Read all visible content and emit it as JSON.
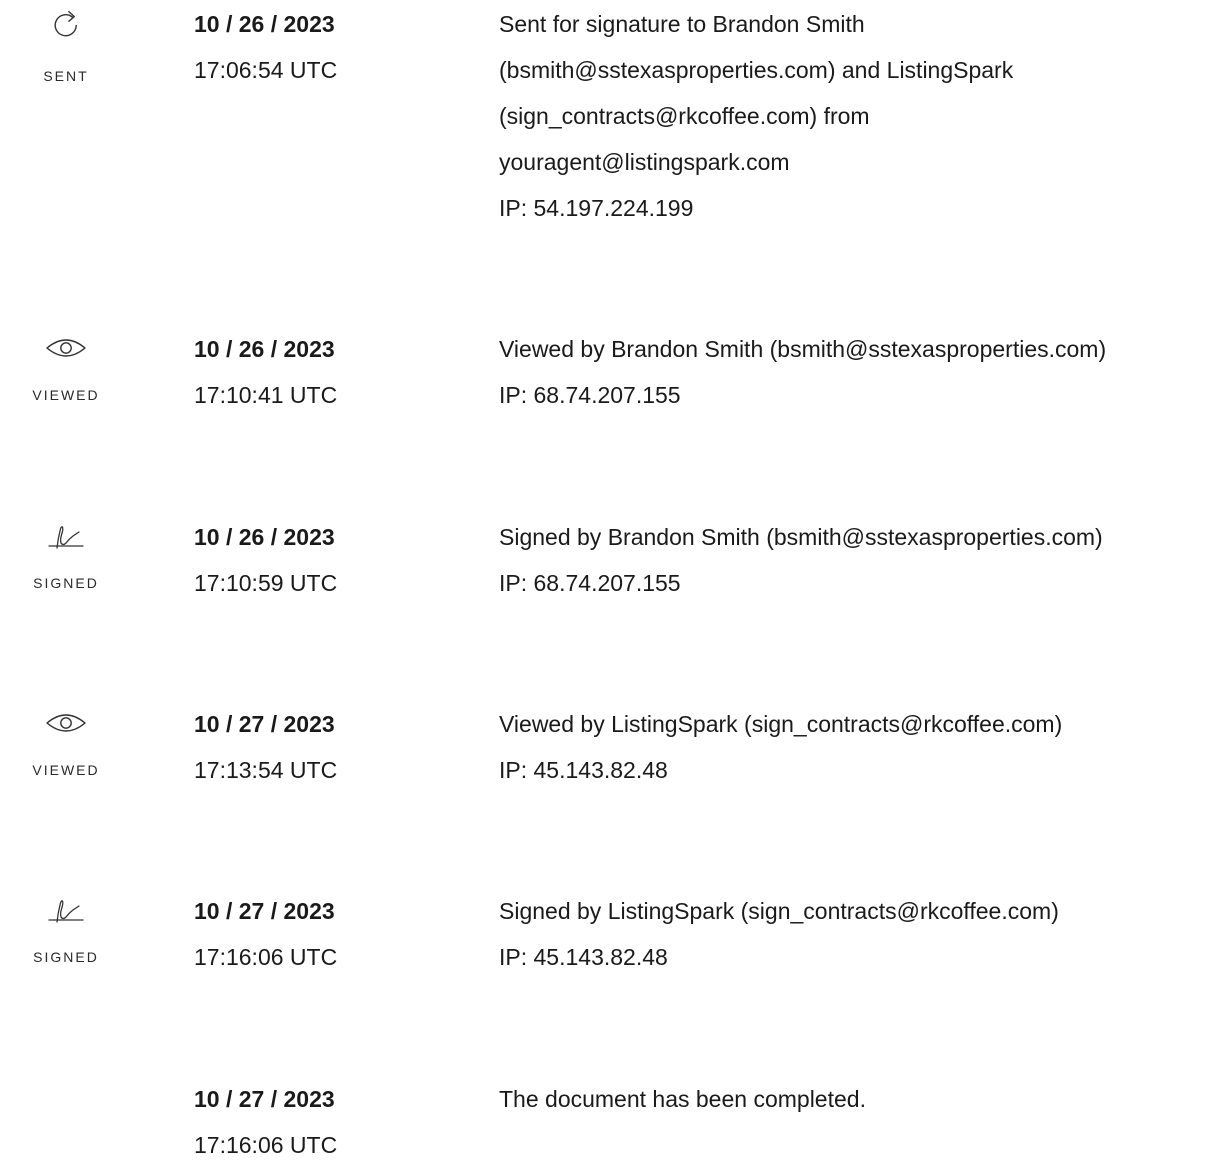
{
  "events": [
    {
      "status": "SENT",
      "icon": "send-arrow-icon",
      "date": "10 / 26 / 2023",
      "time": "17:06:54 UTC",
      "lines": [
        "Sent for signature to Brandon Smith",
        "(bsmith@sstexasproperties.com) and ListingSpark",
        "(sign_contracts@rkcoffee.com) from",
        "youragent@listingspark.com",
        "IP: 54.197.224.199"
      ]
    },
    {
      "status": "VIEWED",
      "icon": "eye-icon",
      "date": "10 / 26 / 2023",
      "time": "17:10:41 UTC",
      "lines": [
        "Viewed by Brandon Smith (bsmith@sstexasproperties.com)",
        "IP: 68.74.207.155"
      ]
    },
    {
      "status": "SIGNED",
      "icon": "signature-icon",
      "date": "10 / 26 / 2023",
      "time": "17:10:59 UTC",
      "lines": [
        "Signed by Brandon Smith (bsmith@sstexasproperties.com)",
        "IP: 68.74.207.155"
      ]
    },
    {
      "status": "VIEWED",
      "icon": "eye-icon",
      "date": "10 / 27 / 2023",
      "time": "17:13:54 UTC",
      "lines": [
        "Viewed by ListingSpark (sign_contracts@rkcoffee.com)",
        "IP: 45.143.82.48"
      ]
    },
    {
      "status": "SIGNED",
      "icon": "signature-icon",
      "date": "10 / 27 / 2023",
      "time": "17:16:06 UTC",
      "lines": [
        "Signed by ListingSpark (sign_contracts@rkcoffee.com)",
        "IP: 45.143.82.48"
      ]
    },
    {
      "status": "",
      "icon": "",
      "date": "10 / 27 / 2023",
      "time": "17:16:06 UTC",
      "lines": [
        "The document has been completed."
      ]
    }
  ]
}
